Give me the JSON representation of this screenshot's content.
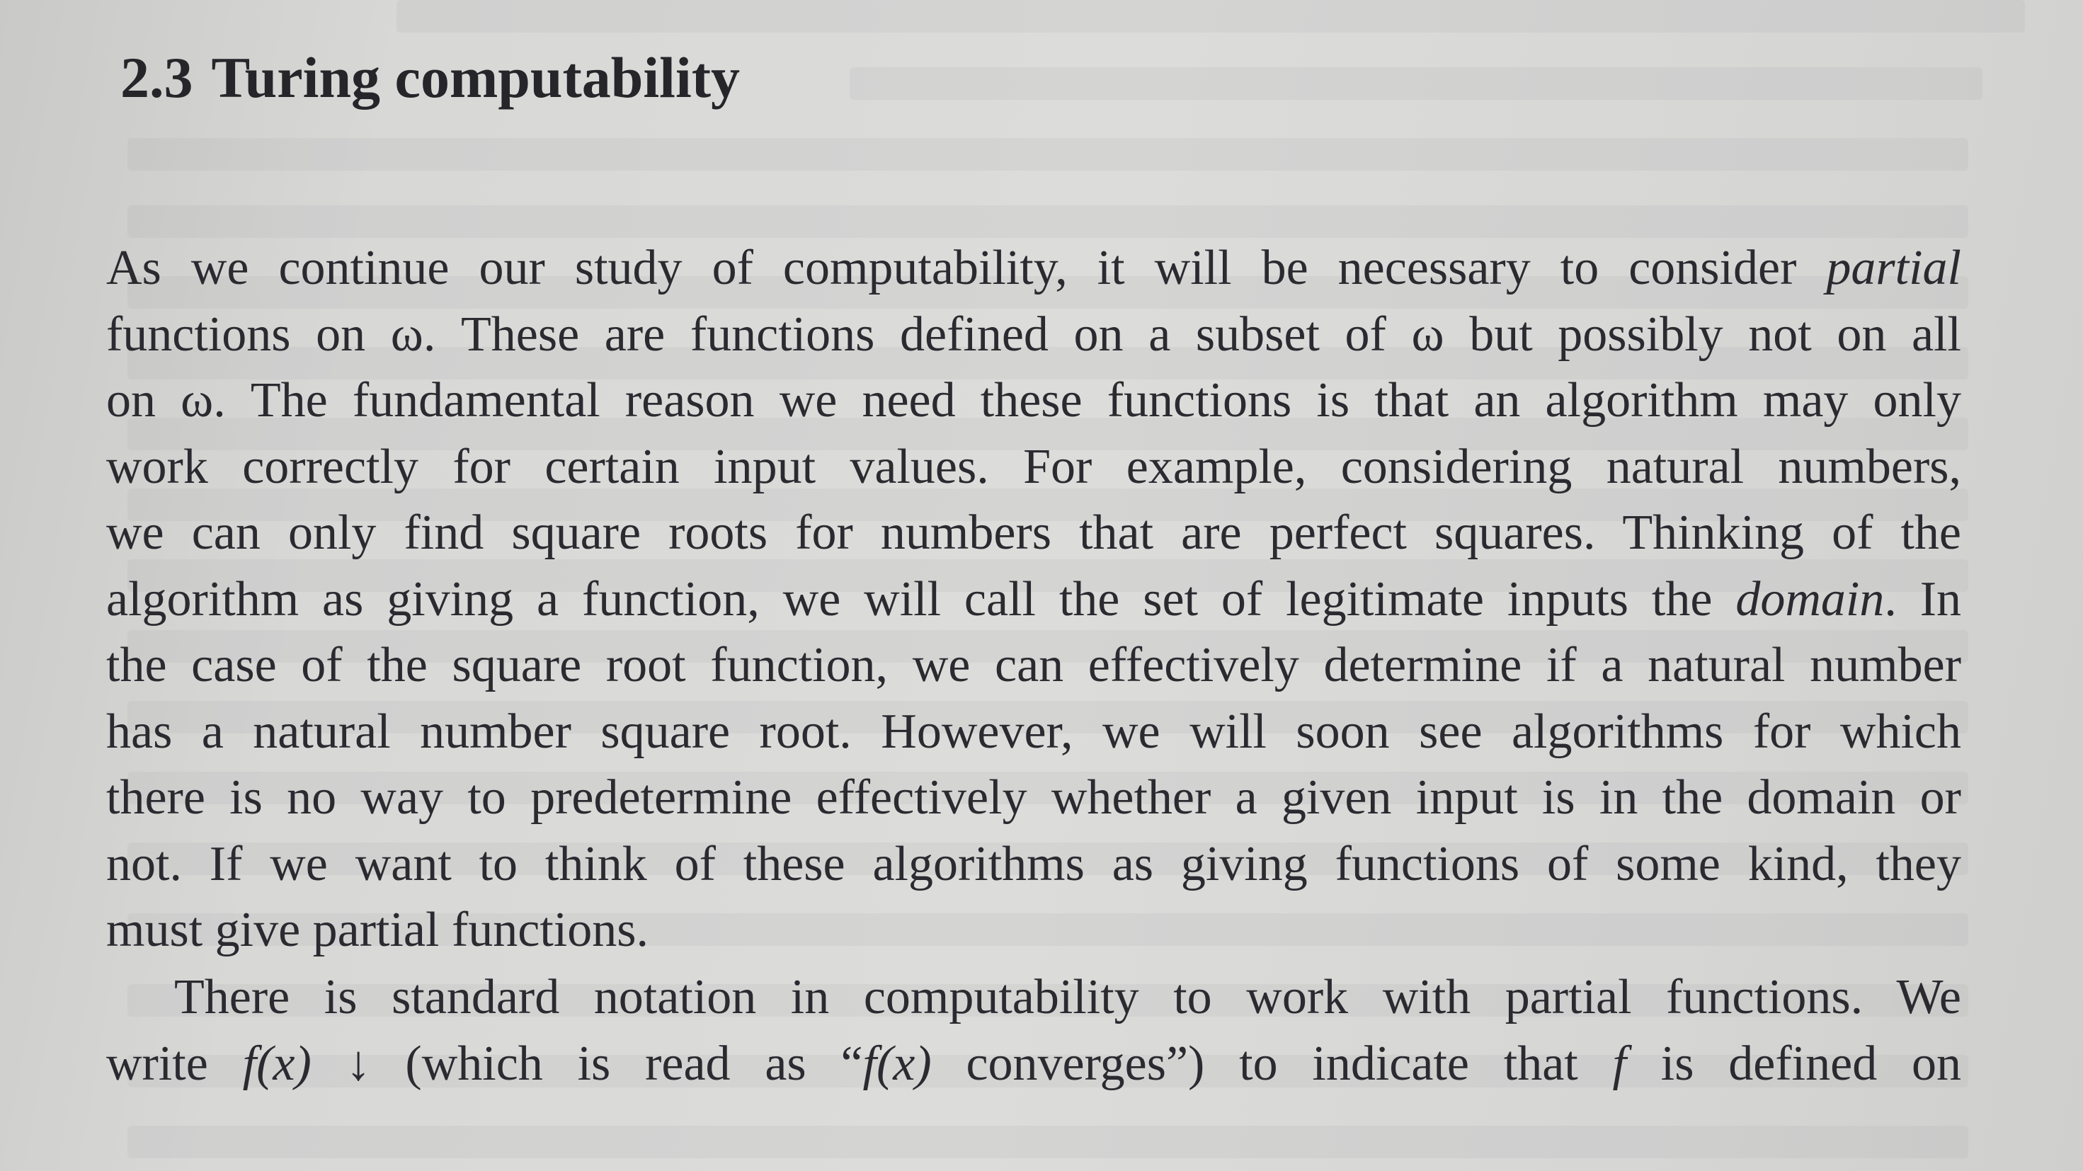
{
  "section": {
    "number": "2.3",
    "title": "Turing computability"
  },
  "paragraph_1": {
    "lines": [
      [
        "As we continue our study of computability, it will be necessary to consider ",
        "partial",
        ""
      ],
      [
        "functions on ω. These are functions defined on a subset of ω but possibly not on all",
        "",
        ""
      ],
      [
        "on ω. The fundamental reason we need these functions is that an algorithm may only",
        "",
        ""
      ],
      [
        "work correctly for certain input values. For example, considering natural numbers,",
        "",
        ""
      ],
      [
        "we can only find square roots for numbers that are perfect squares. Thinking of the",
        "",
        ""
      ],
      [
        "algorithm as giving a function, we will call the set of legitimate inputs the ",
        "domain",
        ". In"
      ],
      [
        "the case of the square root function, we can effectively determine if a natural number",
        "",
        ""
      ],
      [
        "has a natural number square root. However, we will soon see algorithms for which",
        "",
        ""
      ],
      [
        "there is no way to predetermine effectively whether a given input is in the domain or",
        "",
        ""
      ],
      [
        "not. If we want to think of these algorithms as giving functions of some kind, they",
        "",
        ""
      ],
      [
        "must give partial functions.",
        "",
        ""
      ]
    ]
  },
  "paragraph_2": {
    "lines": [
      [
        "There is standard notation in computability to work with partial functions. We",
        "",
        ""
      ],
      [
        "write ",
        "f(x)",
        " ↓ (which is read as “",
        "f(x)",
        " converges”) to indicate that ",
        "f",
        " is defined on"
      ]
    ]
  },
  "colors": {
    "paper": "#d8d8d6",
    "ink": "#2a2a30"
  }
}
